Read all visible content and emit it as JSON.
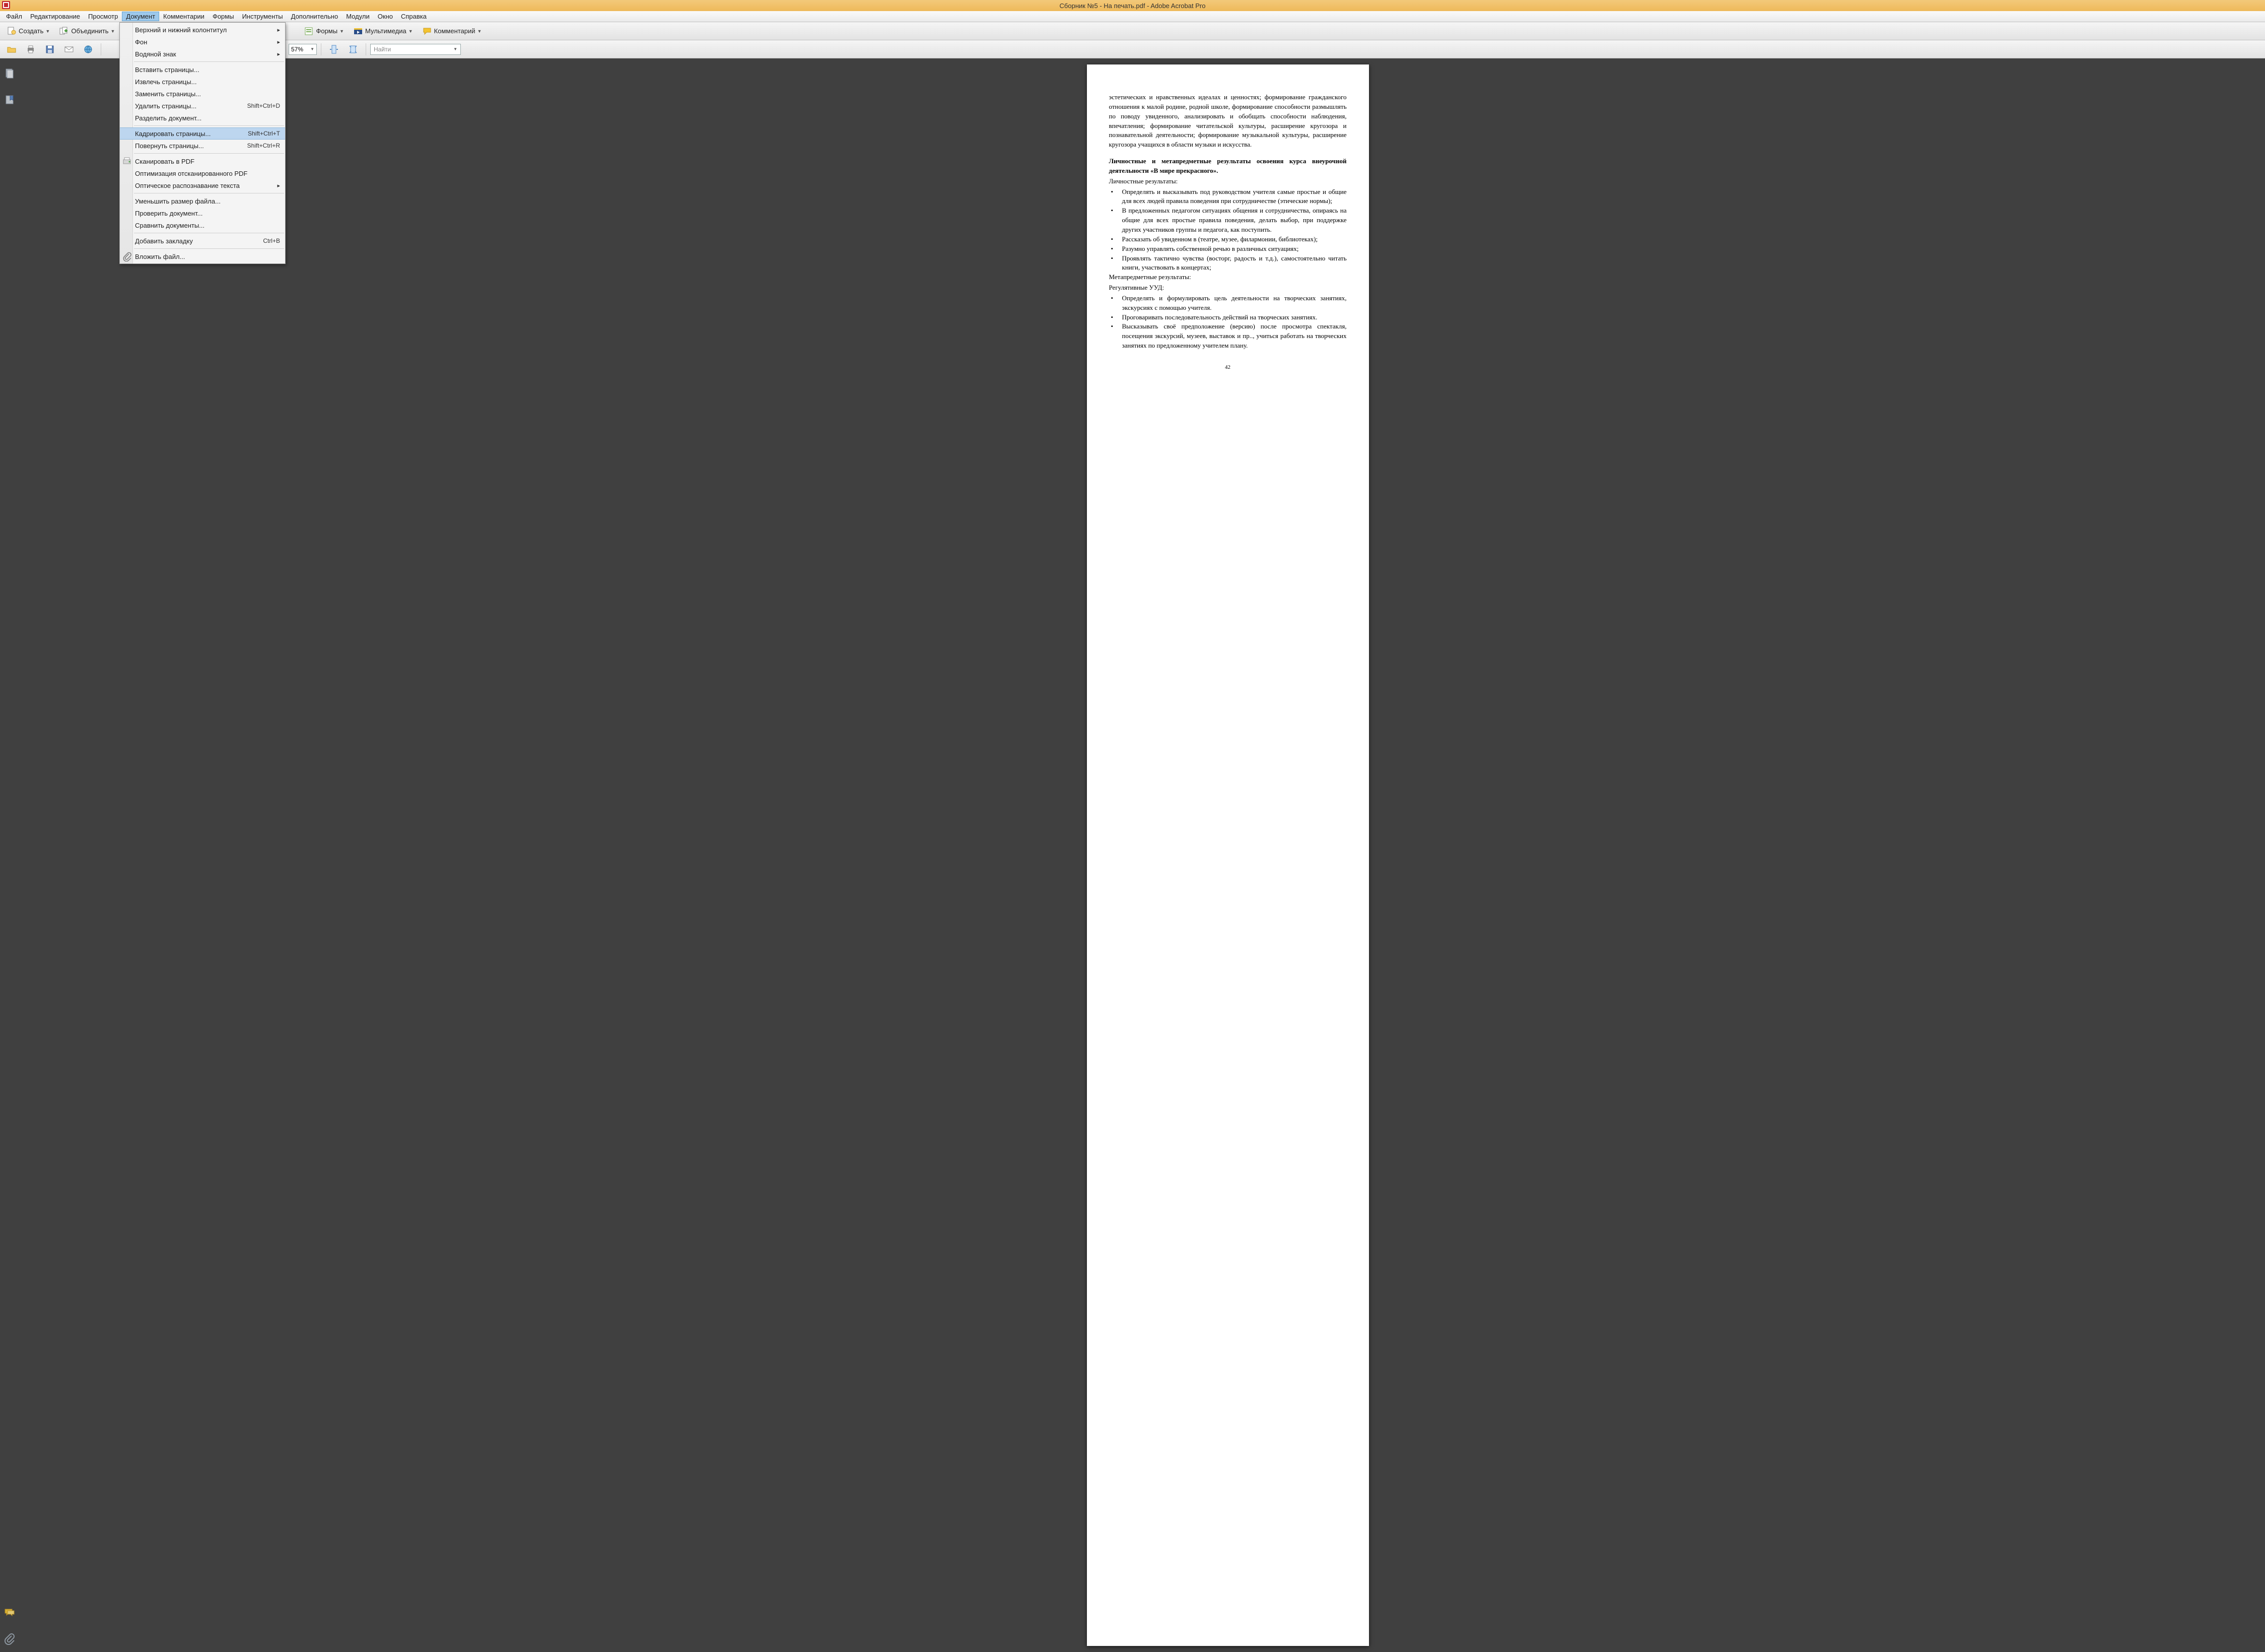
{
  "window": {
    "title": "Сборник №5 - На печать.pdf - Adobe Acrobat Pro"
  },
  "menubar": {
    "items": [
      "Файл",
      "Редактирование",
      "Просмотр",
      "Документ",
      "Комментарии",
      "Формы",
      "Инструменты",
      "Дополнительно",
      "Модули",
      "Окно",
      "Справка"
    ],
    "active_index": 3
  },
  "toolbar1": {
    "create": "Создать",
    "combine": "Объединить",
    "forms": "Формы",
    "multimedia": "Мультимедиа",
    "comment": "Комментарий"
  },
  "toolbar2": {
    "zoom": "57%",
    "find_placeholder": "Найти"
  },
  "dropdown": {
    "items": [
      {
        "type": "item",
        "label": "Верхний и нижний колонтитул",
        "submenu": true
      },
      {
        "type": "item",
        "label": "Фон",
        "submenu": true
      },
      {
        "type": "item",
        "label": "Водяной знак",
        "submenu": true
      },
      {
        "type": "sep"
      },
      {
        "type": "item",
        "label": "Вставить страницы..."
      },
      {
        "type": "item",
        "label": "Извлечь страницы..."
      },
      {
        "type": "item",
        "label": "Заменить страницы..."
      },
      {
        "type": "item",
        "label": "Удалить страницы...",
        "shortcut": "Shift+Ctrl+D"
      },
      {
        "type": "item",
        "label": "Разделить документ..."
      },
      {
        "type": "sep"
      },
      {
        "type": "item",
        "label": "Кадрировать страницы...",
        "shortcut": "Shift+Ctrl+T",
        "hovered": true
      },
      {
        "type": "item",
        "label": "Повернуть страницы...",
        "shortcut": "Shift+Ctrl+R"
      },
      {
        "type": "sep"
      },
      {
        "type": "item",
        "label": "Сканировать в PDF",
        "icon": "scanner"
      },
      {
        "type": "item",
        "label": "Оптимизация отсканированного PDF"
      },
      {
        "type": "item",
        "label": "Оптическое распознавание текста",
        "submenu": true
      },
      {
        "type": "sep"
      },
      {
        "type": "item",
        "label": "Уменьшить размер файла..."
      },
      {
        "type": "item",
        "label": "Проверить документ..."
      },
      {
        "type": "item",
        "label": "Сравнить документы..."
      },
      {
        "type": "sep"
      },
      {
        "type": "item",
        "label": "Добавить закладку",
        "shortcut": "Ctrl+B"
      },
      {
        "type": "sep"
      },
      {
        "type": "item",
        "label": "Вложить файл...",
        "icon": "attach"
      }
    ]
  },
  "document": {
    "page_number": "42",
    "para_top": "эстетических и нравственных идеалах и ценностях; формирование гражданского отношения к малой родине, родной школе, формирование способности размышлять по поводу увиденного, анализировать и обобщать способности наблюдения, впечатления; формирование читательской культуры, расширение кругозора и познавательной деятельности; формирование музыкальной культуры, расширение кругозора учащихся в области музыки и искусства.",
    "heading": "Личностные и метапредметные результаты освоения курса внеурочной деятельности «В мире прекрасного».",
    "sub1": "Личностные результаты:",
    "bullets1": [
      "Определять и высказывать под руководством учителя самые простые и общие для всех людей правила поведения при сотрудничестве (этические нормы);",
      "В предложенных педагогом ситуациях общения и сотрудничества, опираясь на общие для всех простые правила поведения, делать выбор, при поддержке других участников группы и педагога, как поступить.",
      "Рассказать об увиденном в (театре, музее, филармонии, библиотеках);",
      "Разумно управлять собственной речью в различных ситуациях;",
      "Проявлять тактично чувства (восторг, радость и т.д.), самостоятельно читать книги, участвовать в концертах;"
    ],
    "sub2": "Метапредметные результаты:",
    "sub3": "Регулятивные УУД:",
    "bullets2": [
      "Определять и формулировать цель деятельности на творческих занятиях, экскурсиях с помощью учителя.",
      "Проговаривать последовательность действий на творческих занятиях.",
      "Высказывать своё предположение (версию) после просмотра спектакля, посещения экскурсий, музеев, выставок и пр.., учиться работать на творческих занятиях по предложенному учителем плану."
    ]
  }
}
